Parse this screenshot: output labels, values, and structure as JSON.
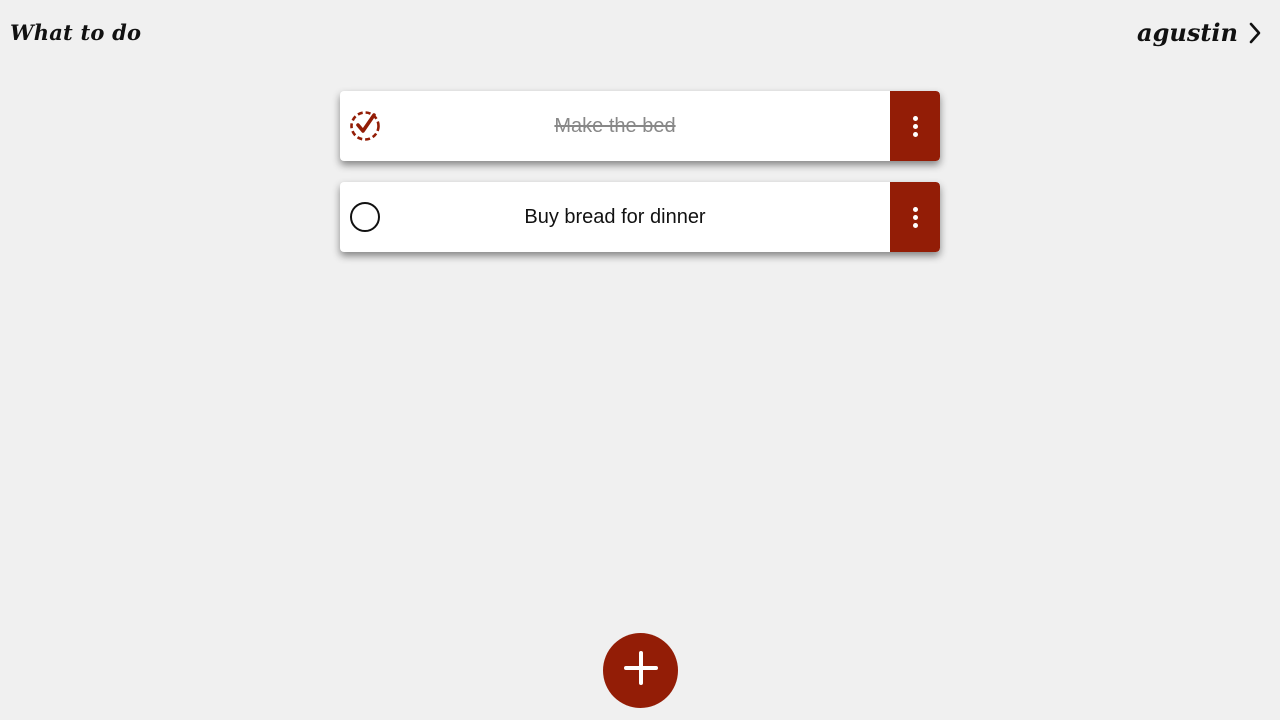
{
  "header": {
    "app_title": "What to do",
    "username": "agustin",
    "user_icon": "chevron-right-icon"
  },
  "todos": [
    {
      "text": "Make the bed",
      "done": true,
      "check_icon": "checked-circle-icon",
      "menu_icon": "more-vertical-icon"
    },
    {
      "text": "Buy bread for dinner",
      "done": false,
      "check_icon": "empty-circle-icon",
      "menu_icon": "more-vertical-icon"
    }
  ],
  "fab": {
    "icon": "plus-icon"
  },
  "colors": {
    "accent": "#931d06",
    "background": "#f0f0f0",
    "card": "#ffffff",
    "done_text": "#888888"
  }
}
